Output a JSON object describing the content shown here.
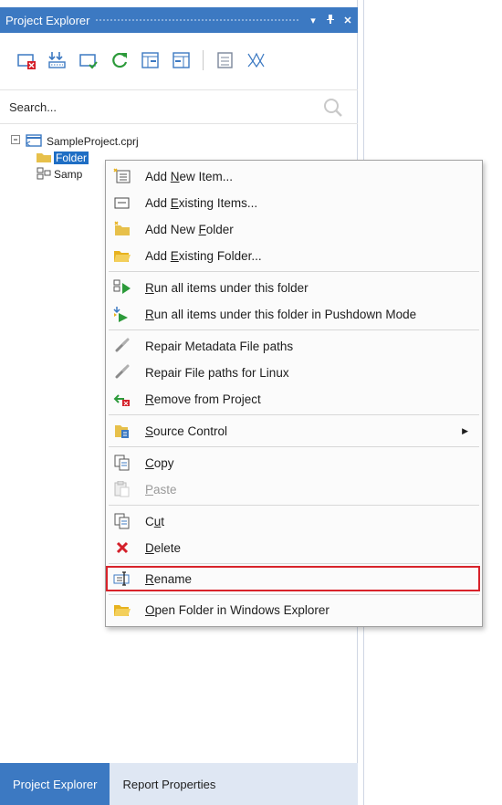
{
  "panel": {
    "title": "Project Explorer",
    "title_buttons": {
      "dropdown": "▾",
      "pin": "ᵽ",
      "close": "✕"
    }
  },
  "search": {
    "placeholder": "Search..."
  },
  "tree": {
    "root": "SampleProject.cprj",
    "folder": "Folder",
    "child": "Samp"
  },
  "bottom_tabs": [
    {
      "label": "Project Explorer",
      "active": true
    },
    {
      "label": "Report Properties",
      "active": false
    }
  ],
  "context_menu": {
    "items": [
      {
        "pre": "Add ",
        "u": "N",
        "post": "ew Item...",
        "icon": "add-new-item-icon"
      },
      {
        "pre": "Add ",
        "u": "E",
        "post": "xisting Items...",
        "icon": "add-existing-items-icon"
      },
      {
        "pre": "Add New ",
        "u": "F",
        "post": "older",
        "icon": "new-folder-icon"
      },
      {
        "pre": "Add ",
        "u": "E",
        "post": "xisting Folder...",
        "icon": "existing-folder-icon"
      },
      {
        "pre": "",
        "u": "R",
        "post": "un all items under this folder",
        "icon": "run-icon"
      },
      {
        "pre": "",
        "u": "R",
        "post": "un all items under this folder in Pushdown Mode",
        "icon": "run-pushdown-icon"
      },
      {
        "pre": "Repair Metadata File paths",
        "u": "",
        "post": "",
        "icon": "link-icon"
      },
      {
        "pre": "Repair File paths for Linux",
        "u": "",
        "post": "",
        "icon": "link-icon"
      },
      {
        "pre": "",
        "u": "R",
        "post": "emove from Project",
        "icon": "remove-icon"
      },
      {
        "pre": "",
        "u": "S",
        "post": "ource Control",
        "icon": "source-control-icon",
        "submenu": "▶"
      },
      {
        "pre": "",
        "u": "C",
        "post": "opy",
        "icon": "copy-icon"
      },
      {
        "pre": "",
        "u": "P",
        "post": "aste",
        "icon": "paste-icon",
        "disabled": true
      },
      {
        "pre": "C",
        "u": "u",
        "post": "t",
        "icon": "cut-icon"
      },
      {
        "pre": "",
        "u": "D",
        "post": "elete",
        "icon": "delete-icon"
      },
      {
        "pre": "",
        "u": "R",
        "post": "ename",
        "icon": "rename-icon",
        "highlighted": true
      },
      {
        "pre": "",
        "u": "O",
        "post": "pen Folder in Windows Explorer",
        "icon": "open-folder-icon"
      }
    ]
  },
  "colors": {
    "accent": "#3c79c2",
    "selection": "#1f6ec4",
    "highlight_border": "#d8222a",
    "delete_red": "#d4202a",
    "run_green": "#2c9a3a",
    "folder_yellow": "#e7c04a"
  }
}
